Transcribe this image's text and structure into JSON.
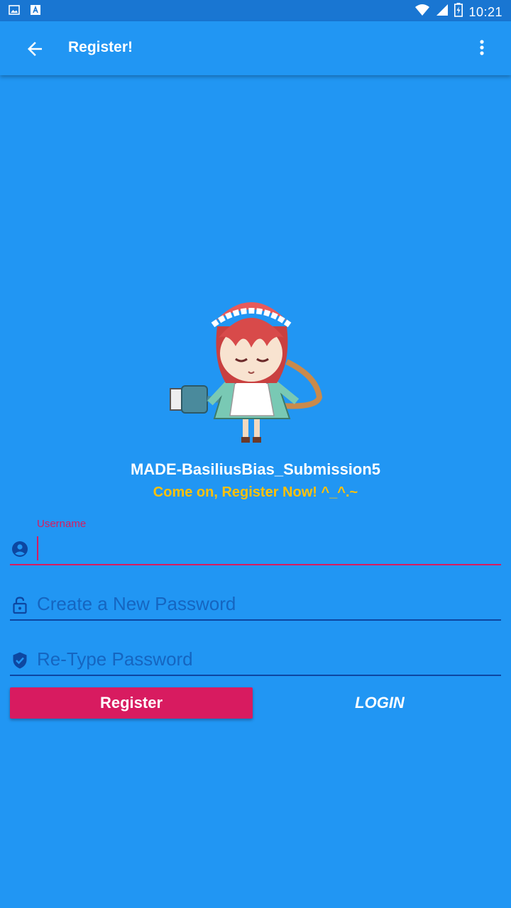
{
  "status_bar": {
    "time": "10:21",
    "left_icons": [
      "image-notification-icon",
      "text-notification-icon"
    ],
    "right_icons": [
      "wifi-icon",
      "cell-signal-icon",
      "battery-charging-icon"
    ]
  },
  "app_bar": {
    "title": "Register!",
    "back_icon": "arrow-back-icon",
    "menu_icon": "more-vert-icon"
  },
  "header": {
    "app_name": "MADE-BasiliusBias_Submission5",
    "tagline": "Come on, Register Now! ^_^.~"
  },
  "form": {
    "username": {
      "label": "Username",
      "value": "",
      "icon": "account-circle-icon"
    },
    "password": {
      "placeholder": "Create a New Password",
      "value": "",
      "icon": "lock-open-icon"
    },
    "retype_password": {
      "placeholder": "Re-Type Password",
      "value": "",
      "icon": "verified-shield-icon"
    }
  },
  "buttons": {
    "register": "Register",
    "login": "LOGIN"
  },
  "colors": {
    "background": "#2196F3",
    "status_bar": "#1976D2",
    "accent": "#D81B60",
    "tagline": "#FFC107",
    "hint_text": "#1565C0"
  }
}
